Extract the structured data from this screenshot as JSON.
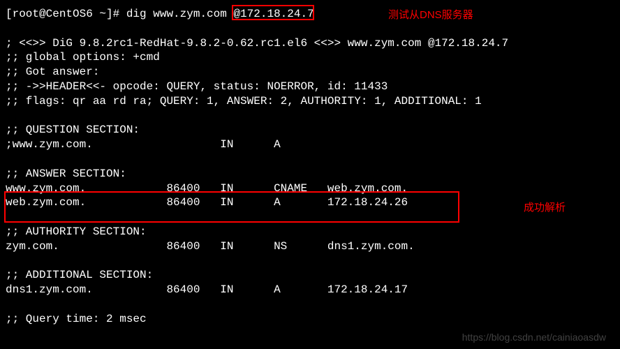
{
  "prompt": {
    "user_host": "[root@CentOS6 ~]# ",
    "command": "dig www.zym.com ",
    "server": "@172.18.24.7"
  },
  "annotations": {
    "test_dns": "测试从DNS服务器",
    "success": "成功解析"
  },
  "header": {
    "version_line": "; <<>> DiG 9.8.2rc1-RedHat-9.8.2-0.62.rc1.el6 <<>> www.zym.com @172.18.24.7",
    "global_options": ";; global options: +cmd",
    "got_answer": ";; Got answer:",
    "header_line": ";; ->>HEADER<<- opcode: QUERY, status: NOERROR, id: 11433",
    "flags_line": ";; flags: qr aa rd ra; QUERY: 1, ANSWER: 2, AUTHORITY: 1, ADDITIONAL: 1"
  },
  "question": {
    "title": ";; QUESTION SECTION:",
    "row": ";www.zym.com.                   IN      A"
  },
  "answer": {
    "title": ";; ANSWER SECTION:",
    "row1": "www.zym.com.            86400   IN      CNAME   web.zym.com.",
    "row2": "web.zym.com.            86400   IN      A       172.18.24.26"
  },
  "authority": {
    "title": ";; AUTHORITY SECTION:",
    "row": "zym.com.                86400   IN      NS      dns1.zym.com."
  },
  "additional": {
    "title": ";; ADDITIONAL SECTION:",
    "row": "dns1.zym.com.           86400   IN      A       172.18.24.17"
  },
  "footer": {
    "query_time": ";; Query time: 2 msec"
  },
  "watermark": "https://blog.csdn.net/cainiaoasdw"
}
